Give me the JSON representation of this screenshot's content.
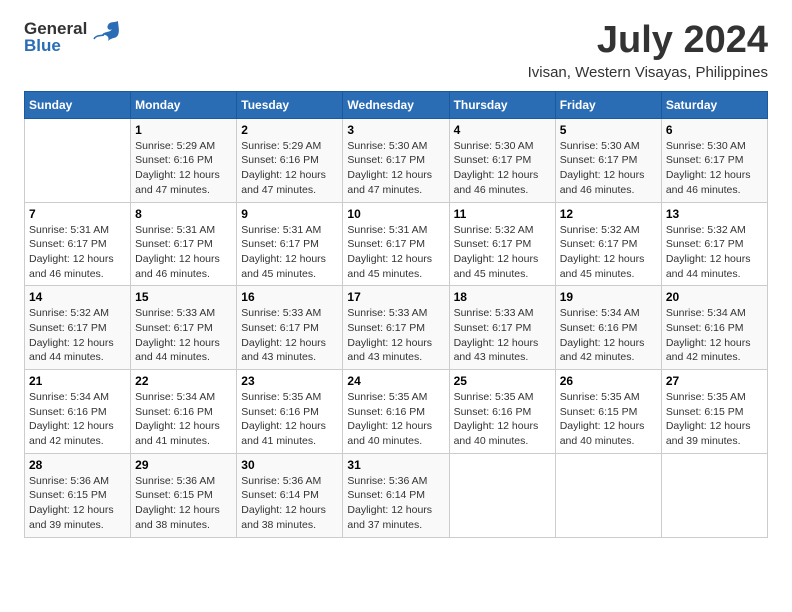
{
  "header": {
    "logo_general": "General",
    "logo_blue": "Blue",
    "title": "July 2024",
    "subtitle": "Ivisan, Western Visayas, Philippines"
  },
  "calendar": {
    "days_of_week": [
      "Sunday",
      "Monday",
      "Tuesday",
      "Wednesday",
      "Thursday",
      "Friday",
      "Saturday"
    ],
    "weeks": [
      [
        {
          "number": "",
          "info": ""
        },
        {
          "number": "1",
          "info": "Sunrise: 5:29 AM\nSunset: 6:16 PM\nDaylight: 12 hours\nand 47 minutes."
        },
        {
          "number": "2",
          "info": "Sunrise: 5:29 AM\nSunset: 6:16 PM\nDaylight: 12 hours\nand 47 minutes."
        },
        {
          "number": "3",
          "info": "Sunrise: 5:30 AM\nSunset: 6:17 PM\nDaylight: 12 hours\nand 47 minutes."
        },
        {
          "number": "4",
          "info": "Sunrise: 5:30 AM\nSunset: 6:17 PM\nDaylight: 12 hours\nand 46 minutes."
        },
        {
          "number": "5",
          "info": "Sunrise: 5:30 AM\nSunset: 6:17 PM\nDaylight: 12 hours\nand 46 minutes."
        },
        {
          "number": "6",
          "info": "Sunrise: 5:30 AM\nSunset: 6:17 PM\nDaylight: 12 hours\nand 46 minutes."
        }
      ],
      [
        {
          "number": "7",
          "info": "Sunrise: 5:31 AM\nSunset: 6:17 PM\nDaylight: 12 hours\nand 46 minutes."
        },
        {
          "number": "8",
          "info": "Sunrise: 5:31 AM\nSunset: 6:17 PM\nDaylight: 12 hours\nand 46 minutes."
        },
        {
          "number": "9",
          "info": "Sunrise: 5:31 AM\nSunset: 6:17 PM\nDaylight: 12 hours\nand 45 minutes."
        },
        {
          "number": "10",
          "info": "Sunrise: 5:31 AM\nSunset: 6:17 PM\nDaylight: 12 hours\nand 45 minutes."
        },
        {
          "number": "11",
          "info": "Sunrise: 5:32 AM\nSunset: 6:17 PM\nDaylight: 12 hours\nand 45 minutes."
        },
        {
          "number": "12",
          "info": "Sunrise: 5:32 AM\nSunset: 6:17 PM\nDaylight: 12 hours\nand 45 minutes."
        },
        {
          "number": "13",
          "info": "Sunrise: 5:32 AM\nSunset: 6:17 PM\nDaylight: 12 hours\nand 44 minutes."
        }
      ],
      [
        {
          "number": "14",
          "info": "Sunrise: 5:32 AM\nSunset: 6:17 PM\nDaylight: 12 hours\nand 44 minutes."
        },
        {
          "number": "15",
          "info": "Sunrise: 5:33 AM\nSunset: 6:17 PM\nDaylight: 12 hours\nand 44 minutes."
        },
        {
          "number": "16",
          "info": "Sunrise: 5:33 AM\nSunset: 6:17 PM\nDaylight: 12 hours\nand 43 minutes."
        },
        {
          "number": "17",
          "info": "Sunrise: 5:33 AM\nSunset: 6:17 PM\nDaylight: 12 hours\nand 43 minutes."
        },
        {
          "number": "18",
          "info": "Sunrise: 5:33 AM\nSunset: 6:17 PM\nDaylight: 12 hours\nand 43 minutes."
        },
        {
          "number": "19",
          "info": "Sunrise: 5:34 AM\nSunset: 6:16 PM\nDaylight: 12 hours\nand 42 minutes."
        },
        {
          "number": "20",
          "info": "Sunrise: 5:34 AM\nSunset: 6:16 PM\nDaylight: 12 hours\nand 42 minutes."
        }
      ],
      [
        {
          "number": "21",
          "info": "Sunrise: 5:34 AM\nSunset: 6:16 PM\nDaylight: 12 hours\nand 42 minutes."
        },
        {
          "number": "22",
          "info": "Sunrise: 5:34 AM\nSunset: 6:16 PM\nDaylight: 12 hours\nand 41 minutes."
        },
        {
          "number": "23",
          "info": "Sunrise: 5:35 AM\nSunset: 6:16 PM\nDaylight: 12 hours\nand 41 minutes."
        },
        {
          "number": "24",
          "info": "Sunrise: 5:35 AM\nSunset: 6:16 PM\nDaylight: 12 hours\nand 40 minutes."
        },
        {
          "number": "25",
          "info": "Sunrise: 5:35 AM\nSunset: 6:16 PM\nDaylight: 12 hours\nand 40 minutes."
        },
        {
          "number": "26",
          "info": "Sunrise: 5:35 AM\nSunset: 6:15 PM\nDaylight: 12 hours\nand 40 minutes."
        },
        {
          "number": "27",
          "info": "Sunrise: 5:35 AM\nSunset: 6:15 PM\nDaylight: 12 hours\nand 39 minutes."
        }
      ],
      [
        {
          "number": "28",
          "info": "Sunrise: 5:36 AM\nSunset: 6:15 PM\nDaylight: 12 hours\nand 39 minutes."
        },
        {
          "number": "29",
          "info": "Sunrise: 5:36 AM\nSunset: 6:15 PM\nDaylight: 12 hours\nand 38 minutes."
        },
        {
          "number": "30",
          "info": "Sunrise: 5:36 AM\nSunset: 6:14 PM\nDaylight: 12 hours\nand 38 minutes."
        },
        {
          "number": "31",
          "info": "Sunrise: 5:36 AM\nSunset: 6:14 PM\nDaylight: 12 hours\nand 37 minutes."
        },
        {
          "number": "",
          "info": ""
        },
        {
          "number": "",
          "info": ""
        },
        {
          "number": "",
          "info": ""
        }
      ]
    ]
  }
}
